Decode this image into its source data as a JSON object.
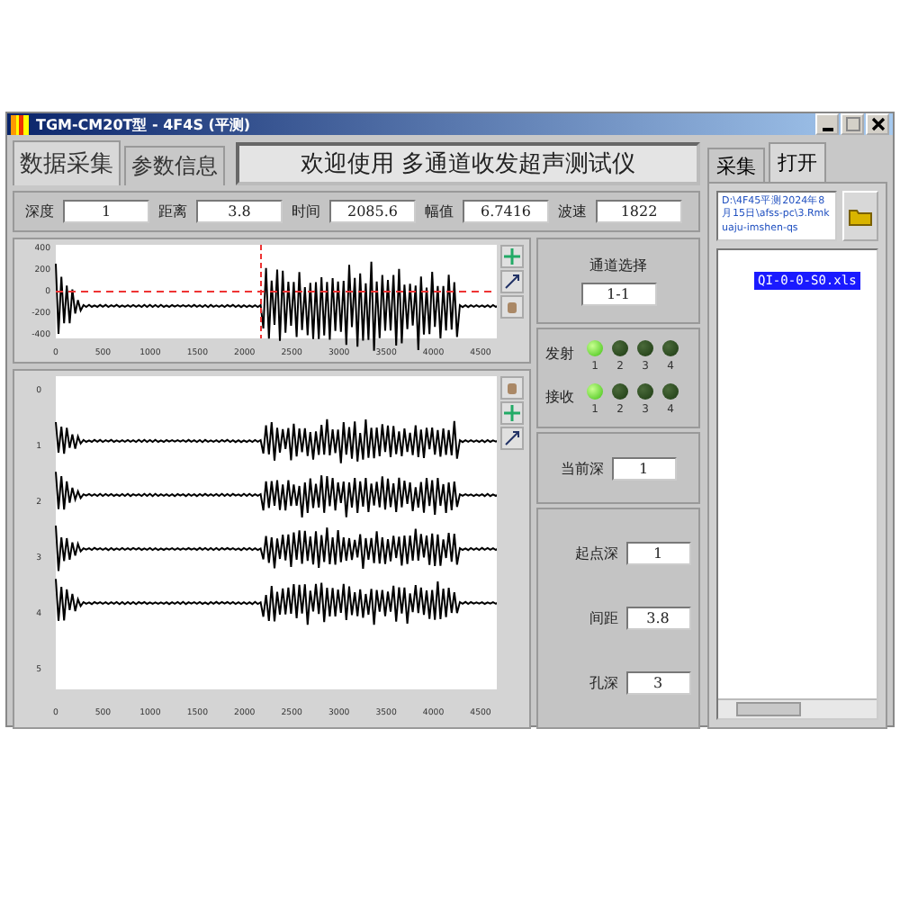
{
  "window": {
    "title": "TGM-CM20T型 - 4F4S (平测)"
  },
  "tabs": [
    {
      "label": "数据采集",
      "selected": true
    },
    {
      "label": "参数信息",
      "selected": false
    }
  ],
  "banner": "欢迎使用 多通道收发超声测试仪",
  "fields": [
    {
      "label": "深度",
      "value": "1"
    },
    {
      "label": "距离",
      "value": "3.8"
    },
    {
      "label": "时间",
      "value": "2085.6"
    },
    {
      "label": "幅值",
      "value": "6.7416"
    },
    {
      "label": "波速",
      "value": "1822"
    }
  ],
  "top_plot": {
    "y_ticks": [
      "400",
      "200",
      "0",
      "-200",
      "-400"
    ],
    "x_ticks": [
      "0",
      "500",
      "1000",
      "1500",
      "2000",
      "2500",
      "3000",
      "3500",
      "4000",
      "4500"
    ]
  },
  "bottom_plot": {
    "y_ticks": [
      "0",
      "1",
      "2",
      "3",
      "4",
      "5"
    ],
    "x_ticks": [
      "0",
      "500",
      "1000",
      "1500",
      "2000",
      "2500",
      "3000",
      "3500",
      "4000",
      "4500"
    ]
  },
  "channel_select": {
    "label": "通道选择",
    "value": "1-1"
  },
  "led_rows": [
    {
      "label": "发射",
      "leds": [
        {
          "label": "1",
          "on": true
        },
        {
          "label": "2",
          "on": false
        },
        {
          "label": "3",
          "on": false
        },
        {
          "label": "4",
          "on": false
        }
      ]
    },
    {
      "label": "接收",
      "leds": [
        {
          "label": "1",
          "on": true
        },
        {
          "label": "2",
          "on": false
        },
        {
          "label": "3",
          "on": false
        },
        {
          "label": "4",
          "on": false
        }
      ]
    }
  ],
  "current_depth": {
    "label": "当前深",
    "value": "1"
  },
  "params": [
    {
      "label": "起点深",
      "value": "1"
    },
    {
      "label": "间距",
      "value": "3.8"
    },
    {
      "label": "孔深",
      "value": "3"
    }
  ],
  "side_tabs": [
    {
      "label": "采集",
      "selected": false
    },
    {
      "label": "打开",
      "selected": true
    }
  ],
  "path": "D:\\4F45平测2024年8月15日\\afss-pc\\3.Rmkuaju-imshen-qs",
  "files": [
    {
      "name": "QI-0-0-S0.xls",
      "selected": true
    }
  ]
}
